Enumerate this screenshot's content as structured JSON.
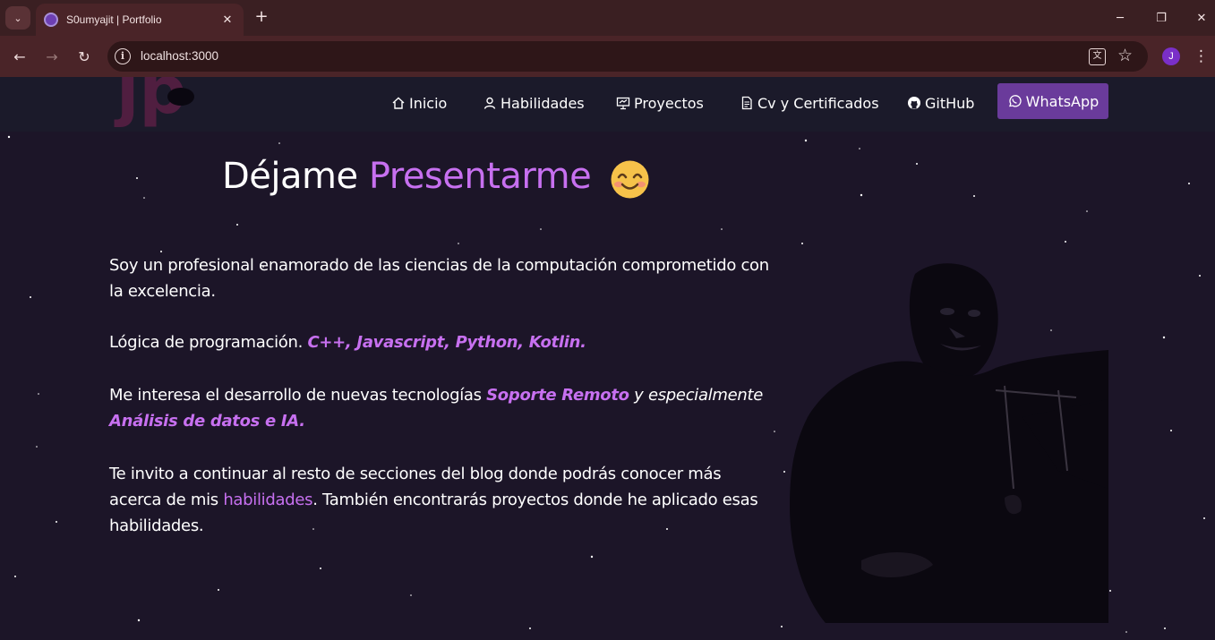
{
  "browser": {
    "tab_title": "S0umyajit | Portfolio",
    "url": "localhost:3000",
    "profile_initial": "J"
  },
  "site": {
    "nav": {
      "inicio": "Inicio",
      "habilidades": "Habilidades",
      "proyectos": "Proyectos",
      "cv": "Cv y Certificados",
      "github": "GitHub",
      "whatsapp": "WhatsApp"
    },
    "heading_prefix": "Déjame",
    "heading_accent": "Presentarme",
    "intro": {
      "p1": "Soy un profesional enamorado de las ciencias de la computación comprometido con la excelencia.",
      "p2_text": "Lógica de programación. ",
      "p2_highlight": "C++, Javascript, Python, Kotlin.",
      "p3_text": "Me interesa el desarrollo de nuevas tecnologías ",
      "p3_highlight1": "Soporte Remoto",
      "p3_italic": " y especialmente ",
      "p3_highlight2": "Análisis de datos e IA.",
      "p4_text_a": "Te invito a continuar al resto de secciones del blog donde podrás conocer más acerca de mis ",
      "p4_link": "habilidades",
      "p4_text_b": ".   También encontrarás proyectos donde he aplicado esas habilidades."
    }
  },
  "colors": {
    "accent": "#c770f0",
    "page_background": "#1c1528",
    "whatsapp_button": "#6a3b9b",
    "browser_frame": "#4a2428"
  }
}
